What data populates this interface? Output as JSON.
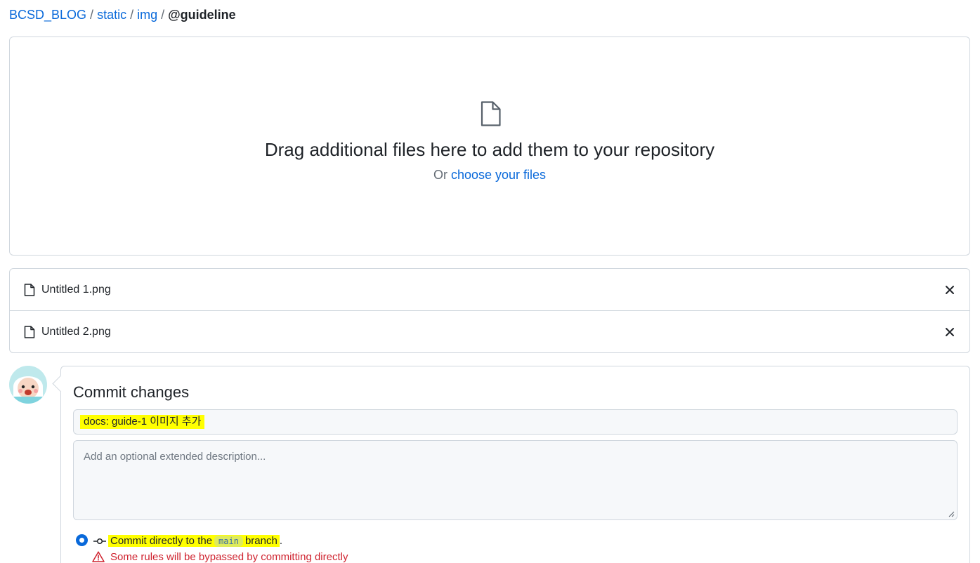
{
  "breadcrumb": {
    "repo": "BCSD_BLOG",
    "sep1": "/",
    "dir1": "static",
    "sep2": "/",
    "dir2": "img",
    "sep3": "/",
    "current": "@guideline"
  },
  "dropzone": {
    "icon": "file-icon",
    "title": "Drag additional files here to add them to your repository",
    "sub_prefix": "Or",
    "sub_link": "choose your files"
  },
  "files": [
    {
      "name": "Untitled 1.png",
      "icon": "file-icon",
      "remove_icon": "x-icon"
    },
    {
      "name": "Untitled 2.png",
      "icon": "file-icon",
      "remove_icon": "x-icon"
    }
  ],
  "commit": {
    "title": "Commit changes",
    "summary_value": "docs: guide-1 이미지 추가",
    "description_placeholder": "Add an optional extended description...",
    "option_direct": {
      "prefix": "Commit directly to the",
      "branch": "main",
      "suffix": "branch",
      "period": "."
    },
    "warning": "Some rules will be bypassed by committing directly"
  },
  "colors": {
    "link": "#0969da",
    "warning": "#cf222e",
    "highlight": "#ffff00",
    "border": "#d0d7de"
  }
}
